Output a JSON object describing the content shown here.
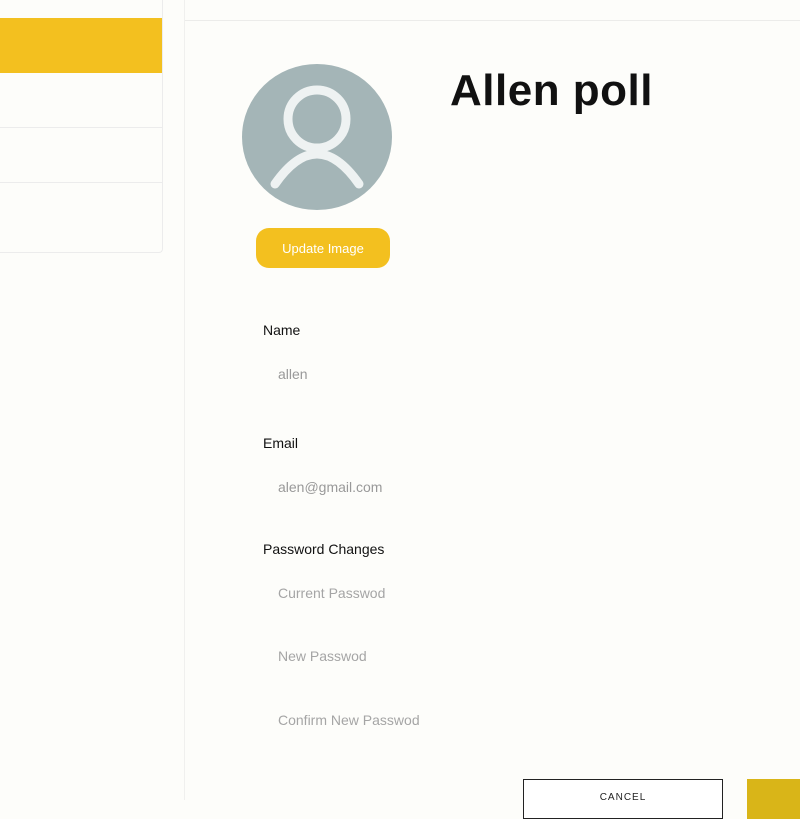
{
  "sidebar": {
    "items": [
      {
        "label": "",
        "active": true
      },
      {
        "label": "",
        "active": false
      },
      {
        "label": "",
        "active": false
      },
      {
        "label": "",
        "active": false
      }
    ]
  },
  "header": {
    "title": ""
  },
  "profile": {
    "avatar_icon": "user-icon",
    "name": "Allen poll",
    "update_image_label": "Update Image"
  },
  "form": {
    "name_label": "Name",
    "name_value": "allen",
    "email_label": "Email",
    "email_value": "alen@gmail.com",
    "password_label": "Password Changes",
    "current_password_placeholder": "Current Passwod",
    "new_password_placeholder": "New Passwod",
    "confirm_password_placeholder": "Confirm New Passwod"
  },
  "actions": {
    "cancel_label": "CANCEL",
    "save_label": ""
  },
  "colors": {
    "accent": "#f3c01f",
    "avatar_bg": "#a4b5b7",
    "background": "#fdfdfa"
  }
}
